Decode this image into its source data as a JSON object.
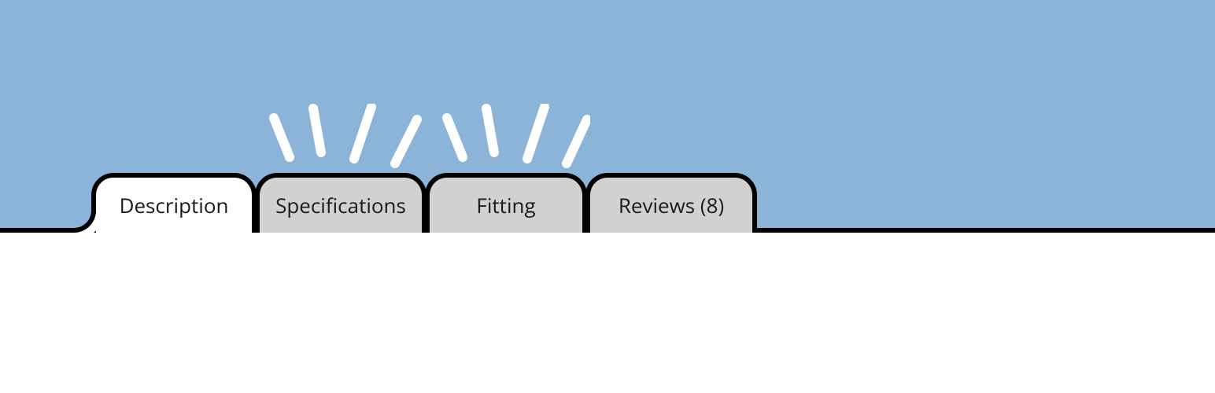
{
  "tabs": [
    {
      "label": "Description",
      "active": true
    },
    {
      "label": "Specifications",
      "active": false
    },
    {
      "label": "Fitting",
      "active": false
    },
    {
      "label": "Reviews (8)",
      "active": false
    }
  ],
  "colors": {
    "background_upper": "#8cb4d8",
    "tab_inactive_bg": "#d1d1d1",
    "tab_active_bg": "#ffffff",
    "border": "#000000"
  }
}
